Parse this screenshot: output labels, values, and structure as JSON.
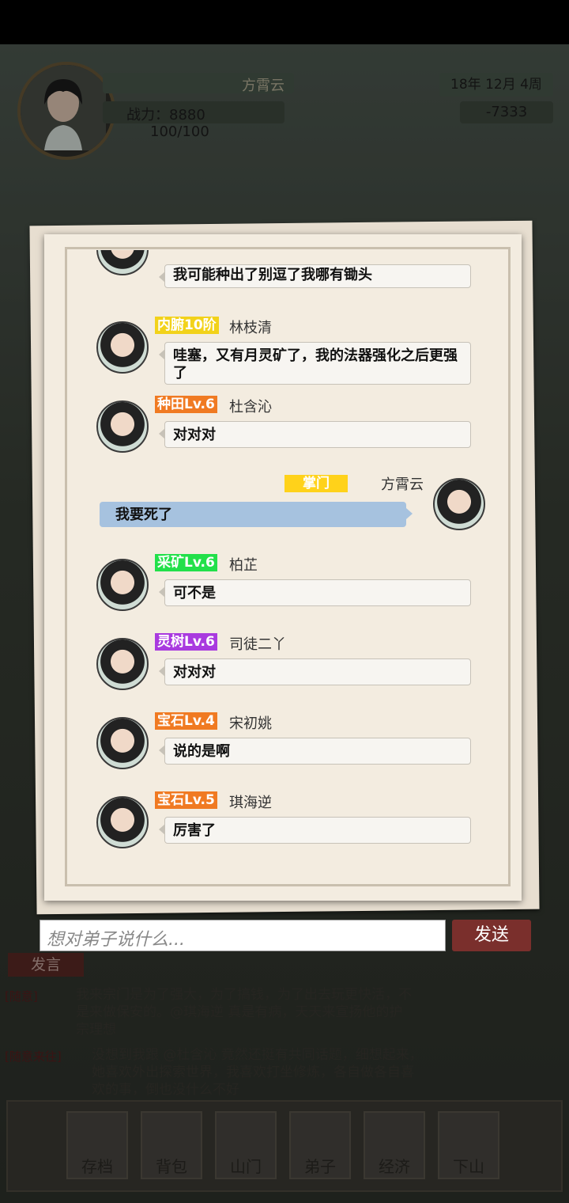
{
  "hud": {
    "player_name": "方霄云",
    "power": "战力：8880",
    "stamina": "100/100",
    "date": "18年 12月  4周",
    "money": "-7333"
  },
  "chat": {
    "messages": [
      {
        "tag": "",
        "name": "",
        "text": "我可能种出了别逗了我哪有锄头",
        "tag_color": ""
      },
      {
        "tag": "内腑10阶",
        "name": "林枝清",
        "text": "哇塞，又有月灵矿了，我的法器强化之后更强了",
        "tag_color": "#f2d21a"
      },
      {
        "tag": "种田Lv.6",
        "name": "杜含沁",
        "text": "对对对",
        "tag_color": "#f07a22"
      },
      {
        "tag": "掌门",
        "name": "方霄云",
        "text": "我要死了",
        "tag_color": "#ffd21a",
        "self": true
      },
      {
        "tag": "采矿Lv.6",
        "name": "柏芷",
        "text": "可不是",
        "tag_color": "#22e04a"
      },
      {
        "tag": "灵树Lv.6",
        "name": "司徒二丫",
        "text": "对对对",
        "tag_color": "#a93adf"
      },
      {
        "tag": "宝石Lv.4",
        "name": "宋初姚",
        "text": "说的是啊",
        "tag_color": "#f07a22"
      },
      {
        "tag": "宝石Lv.5",
        "name": "琪海逆",
        "text": "厉害了",
        "tag_color": "#f07a22"
      }
    ]
  },
  "input": {
    "placeholder": "想对弟子说什么...",
    "send_label": "发送"
  },
  "log": {
    "speak_label": "发言",
    "entry1_tag": "[随意]",
    "entry1": "我来宗门是为了强大，为了搞钱，为了出去玩更快活，不是来做保安的。@琪海逆 真是有病，天天来宣扬他的护宗理想",
    "entry2_tag": "[随意来往]",
    "entry2": "没想到我跟 @杜含沁 竟然还挺有共同话题，细想起来，她喜欢外出探索世界，我喜欢打坐修炼，各自做各自喜欢的事，倒也没什么不好"
  },
  "nav": [
    "存档",
    "背包",
    "山门",
    "弟子",
    "经济",
    "下山"
  ]
}
